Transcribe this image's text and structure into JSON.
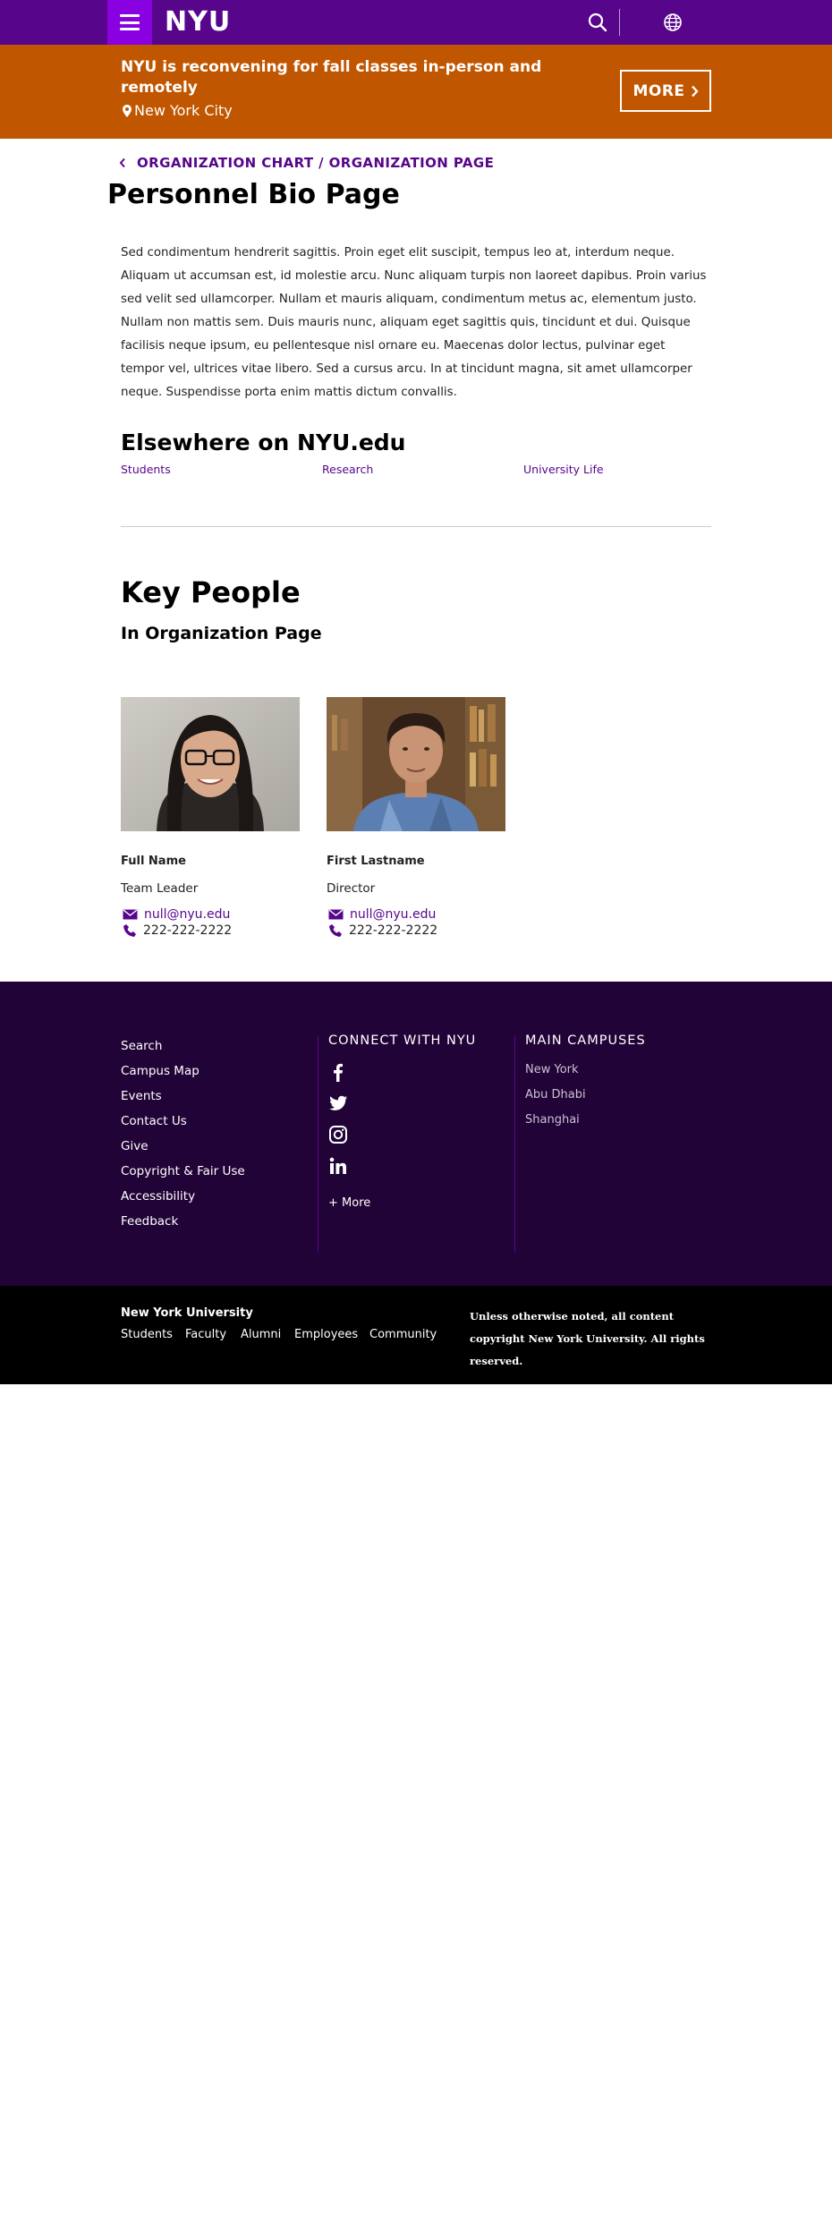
{
  "header": {
    "logo": "NYU",
    "brand_color": "#57068c",
    "menu_color": "#8900e1",
    "icons": [
      "menu-icon",
      "search-icon",
      "globe-icon"
    ]
  },
  "alert": {
    "title": "NYU is reconvening for fall classes in-person and remotely",
    "location": "New York City",
    "more_label": "MORE",
    "color": "#c05600"
  },
  "breadcrumb": {
    "label": "ORGANIZATION CHART / ORGANIZATION PAGE"
  },
  "page": {
    "title": "Personnel Bio Page",
    "body": "Sed condimentum hendrerit sagittis. Proin eget elit suscipit, tempus leo at, interdum neque. Aliquam ut accumsan est, id molestie arcu. Nunc aliquam turpis non laoreet dapibus. Proin varius sed velit sed ullamcorper. Nullam et mauris aliquam, condimentum metus ac, elementum justo. Nullam non mattis sem. Duis mauris nunc, aliquam eget sagittis quis, tincidunt et dui. Quisque facilisis neque ipsum, eu pellentesque nisl ornare eu. Maecenas dolor lectus, pulvinar eget tempor vel, ultrices vitae libero. Sed a cursus arcu. In at tincidunt magna, sit amet ullamcorper neque. Suspendisse porta enim mattis dictum convallis."
  },
  "elsewhere": {
    "title": "Elsewhere on NYU.edu",
    "links": [
      "Students",
      "Research",
      "University Life"
    ]
  },
  "key_people": {
    "title": "Key People",
    "subtitle": "In Organization Page",
    "people": [
      {
        "name": "Full Name",
        "role": "Team Leader",
        "email": "null@nyu.edu",
        "phone": "222-222-2222"
      },
      {
        "name": "First Lastname",
        "role": "Director",
        "email": "null@nyu.edu",
        "phone": "222-222-2222"
      }
    ]
  },
  "footer": {
    "links": [
      "Search",
      "Campus Map",
      "Events",
      "Contact Us",
      "Give",
      "Copyright & Fair Use",
      "Accessibility",
      "Feedback"
    ],
    "connect_title": "CONNECT WITH NYU",
    "social_icons": [
      "facebook-icon",
      "twitter-icon",
      "instagram-icon",
      "linkedin-icon"
    ],
    "more_label": "+ More",
    "campuses_title": "MAIN CAMPUSES",
    "campuses": [
      "New York",
      "Abu Dhabi",
      "Shanghai"
    ],
    "bg_color": "#220337"
  },
  "bottom": {
    "title": "New York University",
    "links": [
      "Students",
      "Faculty",
      "Alumni",
      "Employees",
      "Community"
    ],
    "copyright": "Unless otherwise noted, all content copyright New York University. All rights reserved."
  }
}
